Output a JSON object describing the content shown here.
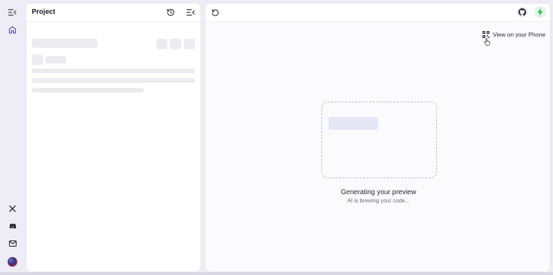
{
  "sidebar": {
    "icons": [
      "collapse-sidebar-icon",
      "home-icon",
      "x-twitter-icon",
      "discord-icon",
      "mail-icon",
      "avatar"
    ]
  },
  "project_panel": {
    "title": "Project",
    "header_icons": [
      "history-icon",
      "panel-collapse-icon"
    ]
  },
  "preview_panel": {
    "header_icons": [
      "refresh-icon",
      "github-icon",
      "bolt-icon"
    ],
    "view_on_phone_label": "View on your Phone",
    "generating_title": "Generating your preview",
    "generating_subtitle": "AI is brewing your code..."
  },
  "colors": {
    "background": "#eeedf6",
    "panel": "#ffffff",
    "skeleton": "#ececf0",
    "bolt_green": "#2fb64c",
    "bolt_circle": "#e3f5e8"
  }
}
